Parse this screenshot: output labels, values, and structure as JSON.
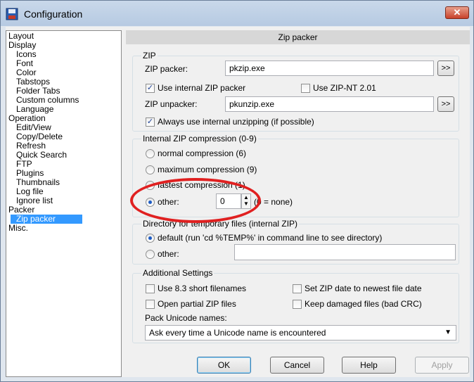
{
  "window": {
    "title": "Configuration",
    "close_glyph": "✕"
  },
  "tree": {
    "items": [
      {
        "label": "Layout",
        "level": 0
      },
      {
        "label": "Display",
        "level": 0
      },
      {
        "label": "Icons",
        "level": 1
      },
      {
        "label": "Font",
        "level": 1
      },
      {
        "label": "Color",
        "level": 1
      },
      {
        "label": "Tabstops",
        "level": 1
      },
      {
        "label": "Folder Tabs",
        "level": 1
      },
      {
        "label": "Custom columns",
        "level": 1
      },
      {
        "label": "Language",
        "level": 1
      },
      {
        "label": "Operation",
        "level": 0
      },
      {
        "label": "Edit/View",
        "level": 1
      },
      {
        "label": "Copy/Delete",
        "level": 1
      },
      {
        "label": "Refresh",
        "level": 1
      },
      {
        "label": "Quick Search",
        "level": 1
      },
      {
        "label": "FTP",
        "level": 1
      },
      {
        "label": "Plugins",
        "level": 1
      },
      {
        "label": "Thumbnails",
        "level": 1
      },
      {
        "label": "Log file",
        "level": 1
      },
      {
        "label": "Ignore list",
        "level": 1
      },
      {
        "label": "Packer",
        "level": 0
      },
      {
        "label": "Zip packer",
        "level": 1,
        "selected": true
      },
      {
        "label": "Misc.",
        "level": 0
      }
    ]
  },
  "panel": {
    "header": "Zip packer"
  },
  "zip_group": {
    "title": "ZIP",
    "packer_label": "ZIP packer:",
    "packer_value": "pkzip.exe",
    "browse_label": ">>",
    "use_internal_packer": "Use internal ZIP packer",
    "use_internal_packer_checked": true,
    "use_zip_nt": "Use ZIP-NT 2.01",
    "use_zip_nt_checked": false,
    "unpacker_label": "ZIP unpacker:",
    "unpacker_value": "pkunzip.exe",
    "always_internal_unzip": "Always use internal unzipping (if possible)",
    "always_internal_unzip_checked": true
  },
  "compression_group": {
    "title": "Internal ZIP compression (0-9)",
    "normal": "normal compression (6)",
    "maximum": "maximum compression (9)",
    "fastest": "fastest compression (1)",
    "other": "other:",
    "other_value": "0",
    "other_hint": "(0 = none)",
    "selected": "other"
  },
  "tempdir_group": {
    "title": "Directory for temporary files (internal ZIP)",
    "default": "default (run 'cd %TEMP%' in command line to see directory)",
    "other": "other:",
    "other_value": "",
    "selected": "default"
  },
  "additional_group": {
    "title": "Additional Settings",
    "use_83": "Use 8.3 short filenames",
    "use_83_checked": false,
    "set_zip_date": "Set ZIP date to newest file date",
    "set_zip_date_checked": false,
    "open_partial": "Open partial ZIP files",
    "open_partial_checked": false,
    "keep_damaged": "Keep damaged files (bad CRC)",
    "keep_damaged_checked": false,
    "pack_unicode_label": "Pack Unicode names:",
    "pack_unicode_value": "Ask every time a Unicode name is encountered"
  },
  "buttons": {
    "ok": "OK",
    "cancel": "Cancel",
    "help": "Help",
    "apply": "Apply"
  },
  "colors": {
    "selection": "#3399ff",
    "annotation": "#e02020"
  }
}
